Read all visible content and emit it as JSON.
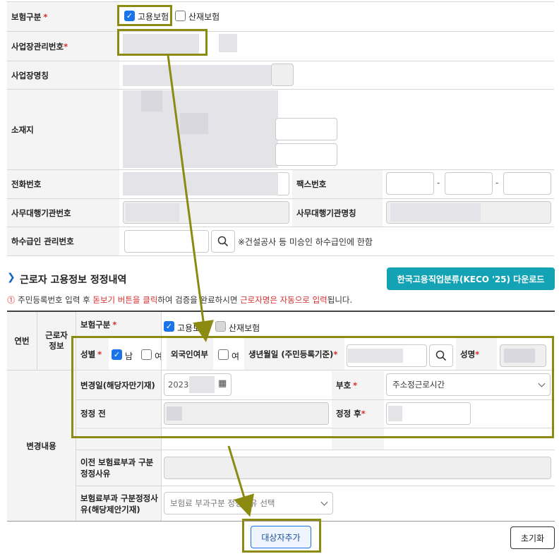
{
  "top_form": {
    "insurance_type_label": "보험구분",
    "employment_insurance": "고용보험",
    "industrial_accident": "산재보험",
    "site_mgmt_no_label": "사업장관리번호",
    "site_name_label": "사업장명칭",
    "address_label": "소재지",
    "phone_label": "전화번호",
    "fax_label": "팩스번호",
    "fax_dash": "-",
    "agency_no_label": "사무대행기관번호",
    "agency_name_label": "사무대행기관명칭",
    "subcontractor_label": "하수급인 관리번호",
    "subcontractor_note": "※건설공사 등 미승인 하수급인에 한함"
  },
  "section": {
    "title": "근로자 고용정보 정정내역",
    "download_button": "한국고용직업분류(KECO '25) 다운로드",
    "notice_part1": "주민등록번호 입력 후 ",
    "notice_red1": "돋보기 버튼을 클릭",
    "notice_part2": "하여 검증을 완료하시면 ",
    "notice_red2": "근로자명은 자동으로 입력",
    "notice_part3": "됩니다."
  },
  "worker_table": {
    "seq_label": "연번",
    "worker_info_label": "근로자 정보",
    "insurance_type_label": "보험구분",
    "employment_insurance": "고용보험",
    "industrial_accident": "산재보험",
    "gender_label": "성별",
    "male": "남",
    "female": "여",
    "foreigner_label": "외국인여부",
    "foreigner_yes": "여",
    "birth_label": "생년월일 (주민등록기준)",
    "name_label": "성명",
    "change_section_label": "변경내용",
    "change_date_label": "변경일(해당자만기재)",
    "change_date_value": "2023-01-01",
    "code_label": "부호",
    "code_value": "주소정근로시간",
    "before_label": "정정 전",
    "after_label": "정정 후",
    "prev_reason_label": "이전 보험료부과 구분 정정사유",
    "reason_label": "보험료부과 구분정정사유(해당제안기재)",
    "reason_placeholder": "보험료 부과구분 정정사유 선택"
  },
  "actions": {
    "add_button": "대상자추가",
    "reset_button": "초기화"
  },
  "colors": {
    "accent_teal": "#13a3b4",
    "highlight_olive": "#8b8b12",
    "checkbox_blue": "#1a73e8",
    "required_red": "#d32f2f"
  }
}
